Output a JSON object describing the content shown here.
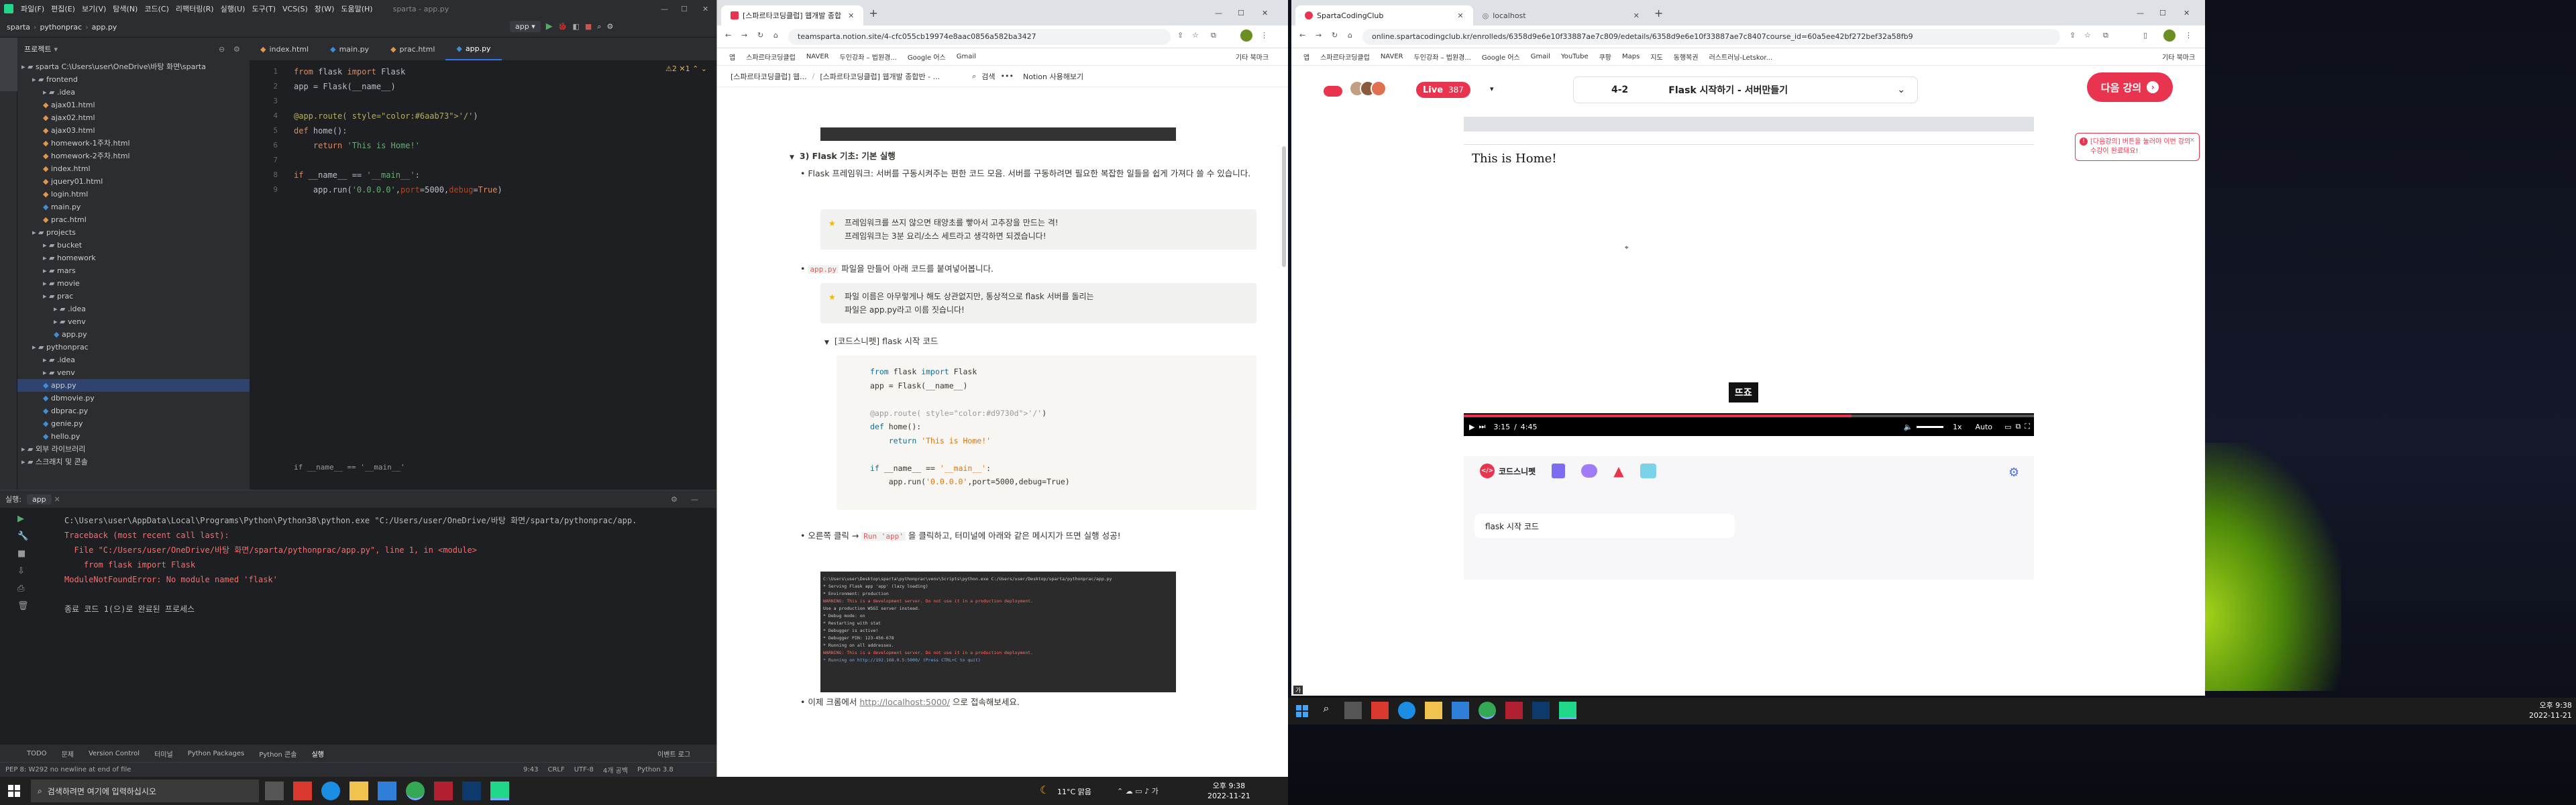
{
  "ide": {
    "menu": [
      "파일(F)",
      "편집(E)",
      "보기(V)",
      "탐색(N)",
      "코드(C)",
      "리팩터링(R)",
      "실행(U)",
      "도구(T)",
      "VCS(S)",
      "창(W)",
      "도움말(H)",
      "sparta - app.py"
    ],
    "breadcrumb": [
      "sparta",
      "pythonprac",
      "app.py"
    ],
    "run_config": "app",
    "editor_tabs": [
      "index.html",
      "main.py",
      "prac.html",
      "app.py"
    ],
    "project_label": "프로젝트",
    "tree": [
      {
        "label": "sparta  C:\\Users\\user\\OneDrive\\바탕 화면\\sparta",
        "indent": 0
      },
      {
        "label": "frontend",
        "indent": 1
      },
      {
        "label": ".idea",
        "indent": 2
      },
      {
        "label": "ajax01.html",
        "indent": 2
      },
      {
        "label": "ajax02.html",
        "indent": 2
      },
      {
        "label": "ajax03.html",
        "indent": 2
      },
      {
        "label": "homework-1주차.html",
        "indent": 2
      },
      {
        "label": "homework-2주차.html",
        "indent": 2
      },
      {
        "label": "index.html",
        "indent": 2
      },
      {
        "label": "jquery01.html",
        "indent": 2
      },
      {
        "label": "login.html",
        "indent": 2
      },
      {
        "label": "main.py",
        "indent": 2
      },
      {
        "label": "prac.html",
        "indent": 2
      },
      {
        "label": "projects",
        "indent": 1
      },
      {
        "label": "bucket",
        "indent": 2
      },
      {
        "label": "homework",
        "indent": 2
      },
      {
        "label": "mars",
        "indent": 2
      },
      {
        "label": "movie",
        "indent": 2
      },
      {
        "label": "prac",
        "indent": 2
      },
      {
        "label": ".idea",
        "indent": 3
      },
      {
        "label": "venv",
        "indent": 3
      },
      {
        "label": "app.py",
        "indent": 3
      },
      {
        "label": "pythonprac",
        "indent": 1
      },
      {
        "label": ".idea",
        "indent": 2
      },
      {
        "label": "venv",
        "indent": 2
      },
      {
        "label": "app.py",
        "indent": 2
      },
      {
        "label": "dbmovie.py",
        "indent": 2
      },
      {
        "label": "dbprac.py",
        "indent": 2
      },
      {
        "label": "genie.py",
        "indent": 2
      },
      {
        "label": "hello.py",
        "indent": 2
      },
      {
        "label": "외부 라이브러리",
        "indent": 0
      },
      {
        "label": "스크래치 및 콘솔",
        "indent": 0
      }
    ],
    "code_lines": [
      "from flask import Flask",
      "app = Flask(__name__)",
      "",
      "@app.route('/')",
      "def home():",
      "    return 'This is Home!'",
      "",
      "if __name__ == '__main__':",
      "    app.run('0.0.0.0',port=5000,debug=True)"
    ],
    "editor_breadcrumb": "if __name__ == '__main__'",
    "run_tab": "실행:",
    "run_name": "app",
    "console_lines": [
      "C:\\Users\\user\\AppData\\Local\\Programs\\Python\\Python38\\python.exe \"C:/Users/user/OneDrive/바탕 화면/sparta/pythonprac/app.",
      "Traceback (most recent call last):",
      "  File \"C:/Users/user/OneDrive/바탕 화면/sparta/pythonprac/app.py\", line 1, in <module>",
      "    from flask import Flask",
      "ModuleNotFoundError: No module named 'flask'",
      "",
      "종료 코드 1(으)로 완료된 프로세스"
    ],
    "bottom_tabs": [
      "TODO",
      "문제",
      "Version Control",
      "터미널",
      "Python Packages",
      "Python 콘솔",
      "실행"
    ],
    "event_log": "이벤트 로그",
    "status_left": "PEP 8: W292 no newline at end of file",
    "status_right": [
      "9:43",
      "CRLF",
      "UTF-8",
      "4개 공백",
      "Python 3.8"
    ]
  },
  "taskbar_left": {
    "search_placeholder": "검색하려면 여기에 입력하십시오",
    "weather": "11°C 맑음",
    "time": "오후 9:38",
    "date": "2022-11-21"
  },
  "notion_window": {
    "tabs": [
      "[스파르타코딩클럽] 웹개발 종합",
      "+"
    ],
    "url": "teamsparta.notion.site/4-cfc055cb19974e8aac0856a582ba3427",
    "bookmarks": [
      "앱",
      "스파르타코딩클럽",
      "NAVER",
      "두인강좌 – 법원경...",
      "Google 어스",
      "Gmail",
      "기타 북마크"
    ],
    "header_title": "[스파르타코딩클럽] 웹...",
    "header_title2": "[스파르타코딩클럽] 웹개발 종합반 - ...",
    "header_search": "검색",
    "header_cta": "Notion 사용해보기",
    "section_title": "3) Flask 기초: 기본 실행",
    "bullet1": "Flask 프레임워크: 서버를 구동시켜주는 편한 코드 모음. 서버를 구동하려면 필요한 복잡한 일들을 쉽게 가져다 쓸 수 있습니다.",
    "callout1": [
      "프레임워크를 쓰지 않으면 태양초를 빻아서 고추장을 만드는 격!",
      "프레임워크는 3분 요리/소스 세트라고 생각하면 되겠습니다!"
    ],
    "bullet2_prefix": "app.py",
    "bullet2": " 파일을 만들어 아래 코드를 붙여넣어봅니다.",
    "callout2": [
      "파일 이름은 아무렇게나 해도 상관없지만, 통상적으로 flask 서버를 돌리는",
      "파일은 app.py라고 이름 짓습니다!"
    ],
    "toggle_title": "[코드스니펫] flask 시작 코드",
    "snippet_lines": [
      "from flask import Flask",
      "app = Flask(__name__)",
      "",
      "@app.route('/')",
      "def home():",
      "    return 'This is Home!'",
      "",
      "if __name__ == '__main__':",
      "    app.run('0.0.0.0',port=5000,debug=True)"
    ],
    "bullet3_a": "오른쪽 클릭 → ",
    "bullet3_code": "Run 'app'",
    "bullet3_b": " 을 클릭하고, 터미널에 아래와 같은 메시지가 뜨면 실행 성공!",
    "terminal_lines": [
      "C:\\Users\\user\\Desktop\\sparta\\pythonprac\\venv\\Scripts\\python.exe C:/Users/user/Desktop/sparta/pythonprac/app.py",
      " * Serving Flask app 'app' (lazy loading)",
      " * Environment: production",
      "   WARNING: This is a development server. Do not use it in a production deployment.",
      "   Use a production WSGI server instead.",
      " * Debug mode: on",
      " * Restarting with stat",
      " * Debugger is active!",
      " * Debugger PIN: 123-456-678",
      " * Running on all addresses.",
      "   WARNING: This is a development server. Do not use it in a production deployment.",
      " * Running on http://192.168.0.5:5000/ (Press CTRL+C to quit)"
    ],
    "bullet4_a": "이제 크롬에서 ",
    "bullet4_link": "http://localhost:5000/",
    "bullet4_b": " 으로 접속해보세요."
  },
  "course_window": {
    "tabs": [
      "SpartaCodingClub",
      "localhost",
      "+"
    ],
    "url": "online.spartacodingclub.kr/enrolleds/6358d9e6e10f33887ae7c809/edetails/6358d9e6e10f33887ae7c8407course_id=60a5ee42bf272bef32a58fb9",
    "bookmarks": [
      "앱",
      "스파르타코딩클럽",
      "NAVER",
      "두인강좌 – 법원경...",
      "Google 어스",
      "Gmail",
      "YouTube",
      "쿠팡",
      "Maps",
      "지도",
      "동행복권",
      "러스트러닝-Letskor...",
      "기타 북마크"
    ],
    "live_label": "Live",
    "live_count": "387",
    "lesson_num": "4-2",
    "lesson_title": "Flask 시작하기 - 서버만들기",
    "next_button": "다음 강의",
    "notice": "[다음강의] 버튼을 눌러야 이번 강의 수강이 완료돼요!",
    "video_text": "This is Home!",
    "subtitle": "뜨죠",
    "time_current": "3:15",
    "time_sep": "/",
    "time_total": "4:45",
    "speed": "1x",
    "quality": "Auto",
    "progress": 0.68,
    "snippet_tab": "코드스니펫",
    "snippet_item": "flask 시작 코드"
  },
  "taskbar_right": {
    "time": "오후 9:38",
    "date": "2022-11-21",
    "lang": "가"
  },
  "colors": {
    "accent_red": "#e8344e",
    "ide_bg": "#1e1f22",
    "error_red": "#ff5555",
    "keyword": "#cf8e6d",
    "string": "#6aab73",
    "decorator": "#b3ae60",
    "notion_bg": "#ffffff"
  }
}
